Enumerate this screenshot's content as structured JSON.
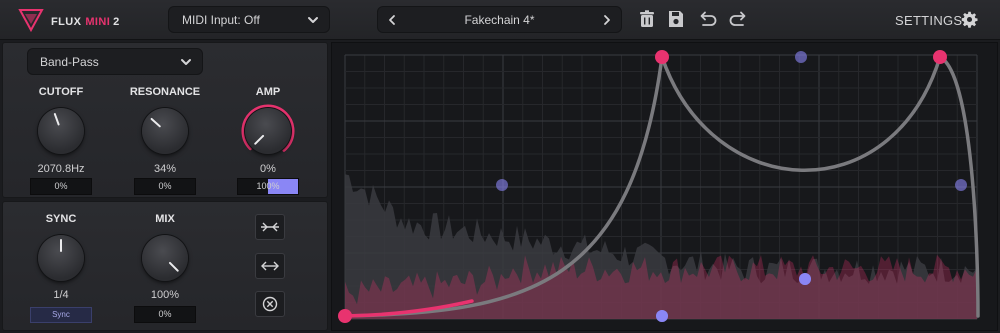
{
  "header": {
    "logo_name": "FLUX",
    "logo_accent": "MINI",
    "logo_version": "2",
    "midi_input": "MIDI Input: Off",
    "preset_name": "Fakechain 4*",
    "settings_label": "SETTINGS",
    "icons": [
      "trash-icon",
      "save-icon",
      "undo-icon",
      "redo-icon",
      "gear-icon"
    ]
  },
  "filter": {
    "type": "Band-Pass",
    "knobs": [
      {
        "title": "CUTOFF",
        "value": "2070.8Hz",
        "mod": "0%"
      },
      {
        "title": "RESONANCE",
        "value": "34%",
        "mod": "0%"
      },
      {
        "title": "AMP",
        "value": "0%",
        "mod": "100%",
        "mod_fraction": 1.0,
        "active": true
      }
    ]
  },
  "lfo": {
    "knobs": [
      {
        "title": "SYNC",
        "value": "1/4",
        "mode": "Sync"
      },
      {
        "title": "MIX",
        "value": "100%",
        "mod": "0%"
      }
    ],
    "buttons": [
      "invert-curve-button",
      "flip-curve-button",
      "clear-curve-button"
    ]
  },
  "colors": {
    "accent": "#e8336f",
    "secondary": "#8a86f5",
    "curve": "#7a7a7e"
  }
}
